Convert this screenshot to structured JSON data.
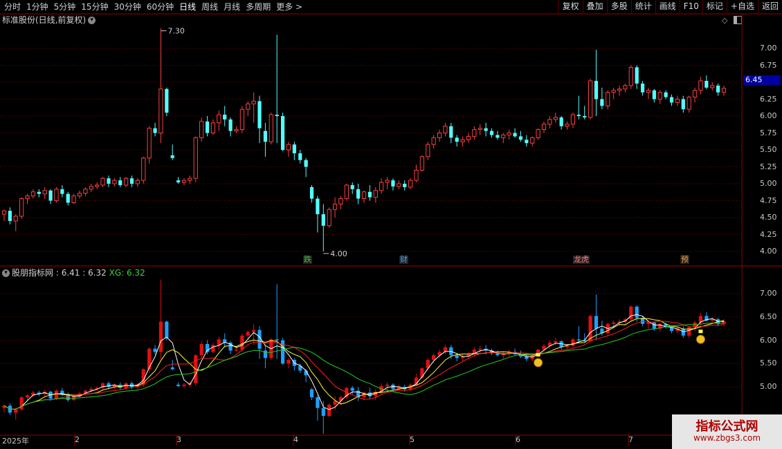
{
  "toolbar": {
    "periods": [
      "分时",
      "1分钟",
      "5分钟",
      "15分钟",
      "30分钟",
      "60分钟",
      "日线",
      "周线",
      "月线",
      "多周期",
      "更多 >"
    ],
    "active": "日线",
    "right_buttons": [
      "复权",
      "叠加",
      "多股",
      "统计",
      "画线",
      "F10",
      "标记",
      "+自选",
      "返回"
    ]
  },
  "main_pane": {
    "title": "标准股份(日线,前复权)",
    "y_ticks": [
      "7.00",
      "6.75",
      "6.50",
      "6.25",
      "6.00",
      "5.75",
      "5.50",
      "5.25",
      "5.00",
      "4.75",
      "4.50",
      "4.25",
      "4.00"
    ],
    "current_price": "6.45",
    "high_label": "7.30",
    "low_label": "4.00",
    "events": [
      {
        "text": "跌",
        "color": "#40c040"
      },
      {
        "text": "财",
        "color": "#40a0ff"
      },
      {
        "text": "龙虎",
        "color": "#ff8080"
      },
      {
        "text": "预",
        "color": "#ffa040"
      }
    ]
  },
  "indicator_pane": {
    "name": "股朋指标网",
    "v1": ": 6.41 : 6.32",
    "xg_label": "XG: 6.32",
    "y_ticks": [
      "7.00",
      "6.50",
      "6.00",
      "5.50",
      "5.00"
    ]
  },
  "x_axis": {
    "labels": [
      "2025年",
      "2",
      "3",
      "4",
      "5",
      "6",
      "7"
    ]
  },
  "watermark": {
    "line1": "指标公式网",
    "line2": "www.zbgs3.com"
  },
  "colors": {
    "up": "#ff4040",
    "down": "#54ffff",
    "down_ind": "#1fa0ff",
    "grid": "#8a0000",
    "ma_white": "#ffffff",
    "ma_yellow": "#ffff40",
    "ma_red": "#ff2020",
    "ma_green": "#20d020"
  },
  "chart_data": {
    "type": "candlestick",
    "ohlc": [
      [
        4.55,
        4.62,
        4.45,
        4.6
      ],
      [
        4.6,
        4.65,
        4.4,
        4.45
      ],
      [
        4.45,
        4.55,
        4.3,
        4.52
      ],
      [
        4.52,
        4.8,
        4.48,
        4.78
      ],
      [
        4.78,
        4.85,
        4.7,
        4.82
      ],
      [
        4.82,
        4.92,
        4.78,
        4.88
      ],
      [
        4.88,
        4.92,
        4.8,
        4.85
      ],
      [
        4.85,
        4.95,
        4.78,
        4.9
      ],
      [
        4.9,
        4.92,
        4.7,
        4.75
      ],
      [
        4.75,
        4.95,
        4.72,
        4.92
      ],
      [
        4.92,
        4.98,
        4.8,
        4.85
      ],
      [
        4.85,
        4.88,
        4.68,
        4.72
      ],
      [
        4.72,
        4.85,
        4.7,
        4.82
      ],
      [
        4.82,
        4.9,
        4.78,
        4.86
      ],
      [
        4.86,
        4.95,
        4.82,
        4.92
      ],
      [
        4.92,
        5.0,
        4.88,
        4.96
      ],
      [
        4.96,
        5.02,
        4.92,
        4.98
      ],
      [
        4.98,
        5.1,
        4.95,
        5.08
      ],
      [
        5.08,
        5.12,
        4.95,
        5.0
      ],
      [
        5.0,
        5.08,
        4.96,
        5.05
      ],
      [
        5.05,
        5.1,
        4.95,
        4.98
      ],
      [
        4.98,
        5.1,
        4.95,
        5.08
      ],
      [
        5.08,
        5.12,
        4.95,
        5.0
      ],
      [
        5.0,
        5.08,
        4.95,
        5.05
      ],
      [
        5.05,
        5.4,
        5.0,
        5.38
      ],
      [
        5.38,
        5.85,
        5.3,
        5.82
      ],
      [
        5.82,
        5.9,
        5.7,
        5.75
      ],
      [
        5.75,
        7.3,
        5.6,
        6.4
      ],
      [
        6.4,
        6.42,
        6.0,
        6.05
      ],
      [
        5.42,
        5.58,
        5.35,
        5.38
      ],
      [
        5.05,
        5.1,
        5.0,
        5.02
      ],
      [
        5.02,
        5.08,
        4.98,
        5.05
      ],
      [
        5.05,
        5.12,
        5.0,
        5.08
      ],
      [
        5.08,
        5.7,
        5.02,
        5.68
      ],
      [
        5.68,
        5.98,
        5.62,
        5.92
      ],
      [
        5.92,
        6.0,
        5.7,
        5.75
      ],
      [
        5.75,
        5.95,
        5.72,
        5.9
      ],
      [
        5.9,
        6.08,
        5.78,
        6.02
      ],
      [
        6.02,
        6.15,
        5.85,
        5.95
      ],
      [
        5.95,
        5.98,
        5.7,
        5.78
      ],
      [
        5.78,
        5.85,
        5.75,
        5.8
      ],
      [
        5.8,
        6.15,
        5.75,
        6.1
      ],
      [
        6.1,
        6.22,
        6.0,
        6.18
      ],
      [
        6.18,
        6.35,
        5.9,
        6.22
      ],
      [
        6.22,
        6.3,
        5.6,
        5.82
      ],
      [
        5.78,
        5.9,
        5.4,
        5.62
      ],
      [
        5.62,
        6.05,
        5.58,
        6.02
      ],
      [
        6.02,
        7.2,
        5.6,
        6.0
      ],
      [
        6.0,
        6.05,
        5.48,
        5.5
      ],
      [
        5.5,
        5.62,
        5.4,
        5.58
      ],
      [
        5.58,
        5.62,
        5.35,
        5.45
      ],
      [
        5.45,
        5.5,
        5.3,
        5.35
      ],
      [
        5.35,
        5.38,
        5.1,
        5.25
      ],
      [
        4.95,
        4.98,
        4.72,
        4.78
      ],
      [
        4.78,
        4.82,
        4.28,
        4.55
      ],
      [
        4.55,
        4.7,
        4.0,
        4.38
      ],
      [
        4.38,
        4.65,
        4.35,
        4.62
      ],
      [
        4.62,
        4.8,
        4.5,
        4.7
      ],
      [
        4.7,
        4.82,
        4.62,
        4.78
      ],
      [
        4.78,
        5.0,
        4.75,
        4.98
      ],
      [
        4.98,
        5.02,
        4.85,
        4.92
      ],
      [
        4.92,
        5.0,
        4.7,
        4.78
      ],
      [
        4.78,
        4.9,
        4.72,
        4.88
      ],
      [
        4.88,
        4.98,
        4.75,
        4.8
      ],
      [
        4.8,
        4.95,
        4.72,
        4.9
      ],
      [
        4.9,
        5.08,
        4.85,
        5.02
      ],
      [
        5.02,
        5.1,
        4.92,
        5.05
      ],
      [
        5.05,
        5.08,
        4.9,
        4.96
      ],
      [
        4.96,
        5.05,
        4.92,
        5.0
      ],
      [
        5.0,
        5.05,
        4.9,
        4.95
      ],
      [
        4.95,
        5.08,
        4.92,
        5.05
      ],
      [
        5.05,
        5.28,
        5.02,
        5.2
      ],
      [
        5.2,
        5.42,
        5.18,
        5.4
      ],
      [
        5.4,
        5.62,
        5.35,
        5.58
      ],
      [
        5.58,
        5.72,
        5.52,
        5.68
      ],
      [
        5.68,
        5.8,
        5.62,
        5.75
      ],
      [
        5.75,
        5.9,
        5.7,
        5.85
      ],
      [
        5.85,
        5.9,
        5.6,
        5.68
      ],
      [
        5.68,
        5.72,
        5.55,
        5.62
      ],
      [
        5.62,
        5.7,
        5.55,
        5.65
      ],
      [
        5.65,
        5.75,
        5.6,
        5.7
      ],
      [
        5.7,
        5.85,
        5.65,
        5.8
      ],
      [
        5.8,
        5.88,
        5.72,
        5.82
      ],
      [
        5.82,
        5.9,
        5.7,
        5.78
      ],
      [
        5.78,
        5.82,
        5.68,
        5.72
      ],
      [
        5.72,
        5.78,
        5.65,
        5.68
      ],
      [
        5.68,
        5.75,
        5.6,
        5.72
      ],
      [
        5.72,
        5.8,
        5.65,
        5.75
      ],
      [
        5.75,
        5.82,
        5.68,
        5.7
      ],
      [
        5.7,
        5.78,
        5.62,
        5.65
      ],
      [
        5.65,
        5.72,
        5.55,
        5.6
      ],
      [
        5.6,
        5.7,
        5.55,
        5.68
      ],
      [
        5.68,
        5.82,
        5.65,
        5.8
      ],
      [
        5.8,
        5.92,
        5.75,
        5.88
      ],
      [
        5.88,
        6.0,
        5.82,
        5.95
      ],
      [
        5.95,
        6.05,
        5.9,
        5.98
      ],
      [
        5.98,
        6.0,
        5.8,
        5.85
      ],
      [
        5.85,
        5.92,
        5.8,
        5.88
      ],
      [
        5.88,
        6.05,
        5.82,
        6.02
      ],
      [
        6.02,
        6.3,
        5.95,
        6.0
      ],
      [
        6.0,
        6.15,
        5.95,
        5.98
      ],
      [
        5.98,
        6.55,
        5.95,
        6.52
      ],
      [
        6.52,
        6.98,
        6.0,
        6.25
      ],
      [
        6.25,
        6.42,
        6.1,
        6.15
      ],
      [
        6.15,
        6.38,
        6.1,
        6.35
      ],
      [
        6.35,
        6.42,
        6.25,
        6.38
      ],
      [
        6.38,
        6.45,
        6.3,
        6.4
      ],
      [
        6.4,
        6.48,
        6.35,
        6.45
      ],
      [
        6.45,
        6.75,
        6.4,
        6.72
      ],
      [
        6.72,
        6.75,
        6.4,
        6.48
      ],
      [
        6.48,
        6.52,
        6.3,
        6.35
      ],
      [
        6.35,
        6.42,
        6.25,
        6.38
      ],
      [
        6.38,
        6.4,
        6.2,
        6.25
      ],
      [
        6.25,
        6.38,
        6.18,
        6.35
      ],
      [
        6.35,
        6.38,
        6.25,
        6.28
      ],
      [
        6.28,
        6.32,
        6.15,
        6.2
      ],
      [
        6.2,
        6.3,
        6.15,
        6.25
      ],
      [
        6.25,
        6.3,
        6.05,
        6.1
      ],
      [
        6.1,
        6.3,
        6.05,
        6.28
      ],
      [
        6.28,
        6.42,
        6.2,
        6.38
      ],
      [
        6.38,
        6.58,
        6.32,
        6.52
      ],
      [
        6.52,
        6.6,
        6.4,
        6.42
      ],
      [
        6.42,
        6.5,
        6.38,
        6.45
      ],
      [
        6.45,
        6.48,
        6.3,
        6.35
      ],
      [
        6.35,
        6.45,
        6.3,
        6.41
      ]
    ]
  }
}
